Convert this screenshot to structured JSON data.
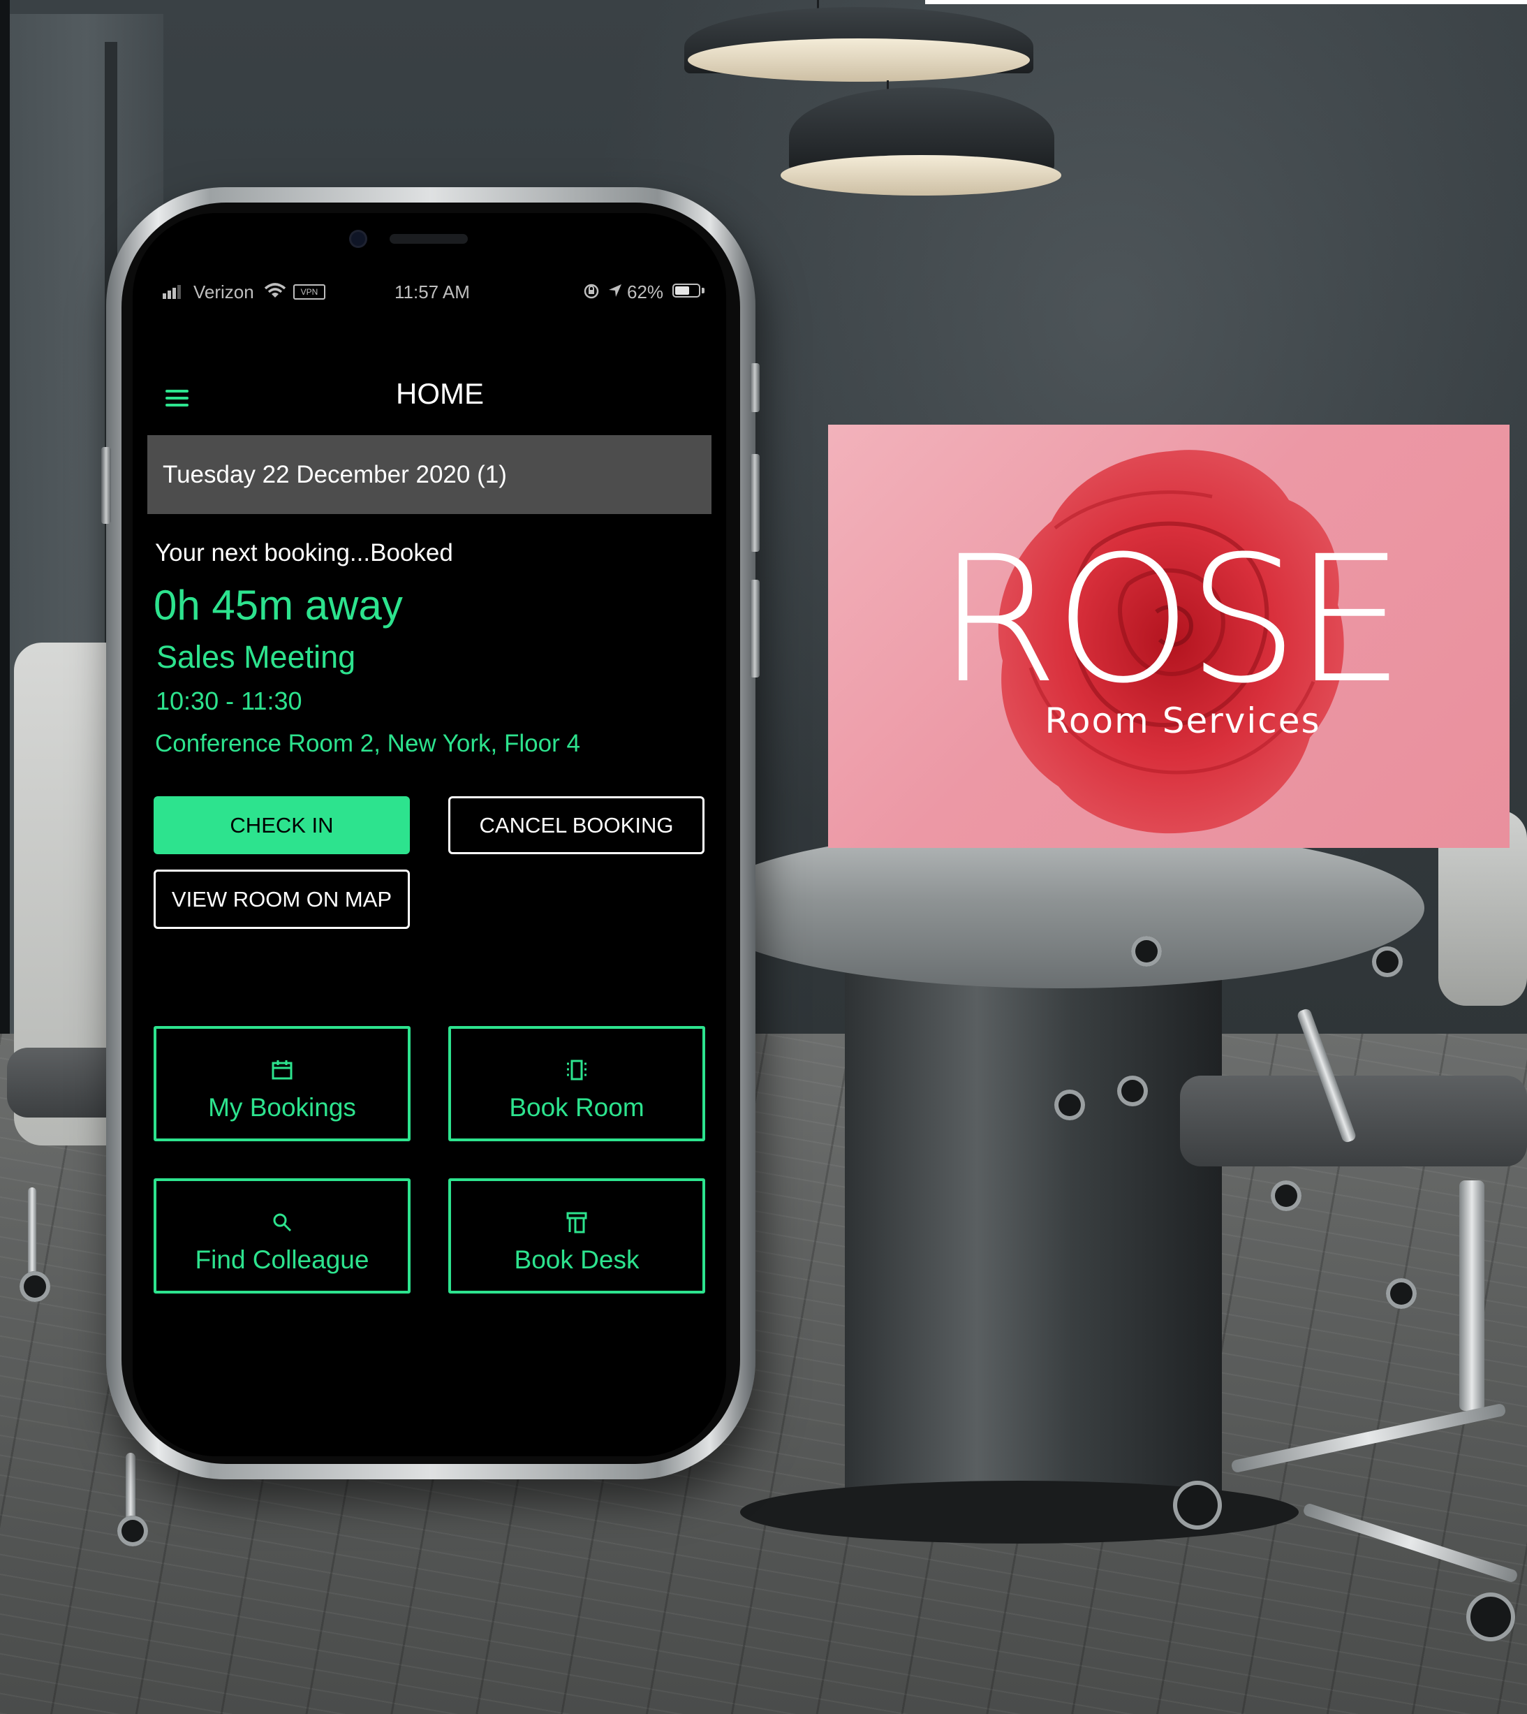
{
  "status_bar": {
    "carrier": "Verizon",
    "vpn": "VPN",
    "time": "11:57 AM",
    "battery": "62%",
    "battery_level": 0.62,
    "icons": [
      "signal-icon",
      "wifi-icon",
      "vpn-icon",
      "orientation-lock-icon",
      "location-icon",
      "battery-icon"
    ]
  },
  "header": {
    "menu_icon": "hamburger-menu-icon",
    "title": "HOME"
  },
  "date_bar": {
    "label": "Tuesday 22 December 2020 (1)"
  },
  "booking": {
    "next_label": "Your next booking...Booked",
    "countdown": "0h 45m away",
    "title": "Sales Meeting",
    "time_range": "10:30 - 11:30",
    "location": "Conference Room 2, New York, Floor 4"
  },
  "actions": {
    "check_in": "CHECK IN",
    "cancel_booking": "CANCEL BOOKING",
    "view_room_on_map": "VIEW ROOM ON MAP"
  },
  "tiles": [
    {
      "label": "My Bookings",
      "icon": "calendar-icon"
    },
    {
      "label": "Book Room",
      "icon": "door-icon"
    },
    {
      "label": "Find Colleague",
      "icon": "search-icon"
    },
    {
      "label": "Book Desk",
      "icon": "desk-icon"
    }
  ],
  "brand": {
    "title": "ROSE",
    "subtitle": "Room Services"
  },
  "colors": {
    "accent": "#2de38e",
    "screen_bg": "#000000",
    "date_bar_bg": "#4d4d4d",
    "brand_bg": "#ec98a5",
    "rose_red": "#d9303c"
  }
}
